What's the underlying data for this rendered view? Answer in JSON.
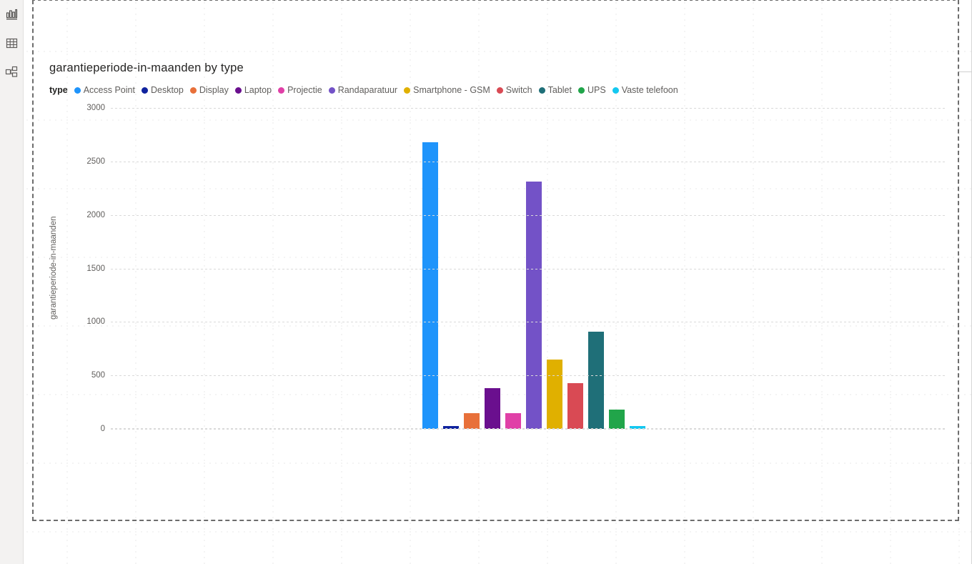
{
  "sidebar": {
    "items": [
      {
        "name": "report-view",
        "icon": "bar-chart-icon",
        "selected": true
      },
      {
        "name": "data-view",
        "icon": "table-grid-icon",
        "selected": false
      },
      {
        "name": "model-view",
        "icon": "model-relationships-icon",
        "selected": false
      }
    ]
  },
  "chart_data": {
    "type": "bar",
    "title": "garantieperiode-in-maanden by type",
    "legend_title": "type",
    "xlabel": "",
    "ylabel": "garantieperiode-in-maanden",
    "ylim": [
      0,
      3000
    ],
    "yticks": [
      0,
      500,
      1000,
      1500,
      2000,
      2500,
      3000
    ],
    "ytick_labels": [
      "0",
      "500",
      "1000",
      "1500",
      "2000",
      "2500",
      "3000"
    ],
    "grid": true,
    "legend_position": "top-left",
    "categories": [
      "Access Point",
      "Desktop",
      "Display",
      "Laptop",
      "Projectie",
      "Randaparatuur",
      "Smartphone - GSM",
      "Switch",
      "Tablet",
      "UPS",
      "Vaste telefoon"
    ],
    "values": [
      2680,
      30,
      150,
      380,
      150,
      2310,
      650,
      430,
      910,
      180,
      25
    ],
    "colors": [
      "#1f94fb",
      "#10239e",
      "#e8703a",
      "#6a0f8e",
      "#e040a7",
      "#7352c7",
      "#e0b000",
      "#d94a54",
      "#1f6f78",
      "#21a54a",
      "#14c8f0"
    ]
  }
}
